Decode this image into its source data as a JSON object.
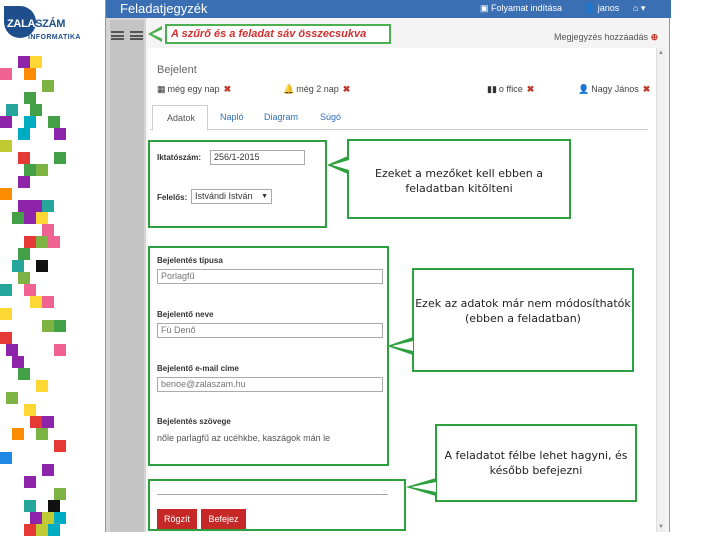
{
  "brand": {
    "logo_top": "ZALA",
    "logo_accent": "SZÁM",
    "logo_bottom": "INFORMATIKA",
    "brand_color": "#1e4f8c"
  },
  "navbar": {
    "title": "Feladatjegyzék",
    "process_start": "Folyamat indítása",
    "user": "janos",
    "home": "⌂ ▾",
    "color": "#3a6fb4"
  },
  "annotation_top": "A szűrő és a feladat sáv összecsukva",
  "add_event": "Megjegyzés hozzáadás",
  "section_title": "Bejelent",
  "meta": {
    "due_one": "még egy nap",
    "due_two": "még 2 nap",
    "office": "o ffice",
    "owner": "Nagy János"
  },
  "tabs": [
    "Adatok",
    "Napló",
    "Diagram",
    "Súgó"
  ],
  "form": {
    "iktatoszam_label": "Iktatószám:",
    "iktatoszam_value": "256/1-2015",
    "felelos_label": "Felelős:",
    "felelos_value": "Istvándi István",
    "tipus_label": "Bejelentés típusa",
    "tipus_value": "Porlagfű",
    "nev_label": "Bejelentő neve",
    "nev_value": "Fü Denő",
    "email_label": "Bejelentő e-mail címe",
    "email_value": "benoe@zalaszam.hu",
    "szoveg_label": "Bejelentés szövege",
    "szoveg_value": "nőle parlagfű az ucéhkbe, kaszágok mán le"
  },
  "callouts": {
    "fill_fields": "Ezeket a mezőket kell ebben a feladatban kitölteni",
    "readonly": "Ezek az adatok már nem módosíthatók (ebben a feladatban)",
    "pause": "A feladatot félbe lehet hagyni, és később befejezni"
  },
  "buttons": {
    "save": "Rögzít",
    "finish": "Befejez"
  },
  "colors": {
    "annotation_border": "#2e9f3e",
    "annotation_text_red": "#d32f2f",
    "button_red": "#c62828"
  }
}
